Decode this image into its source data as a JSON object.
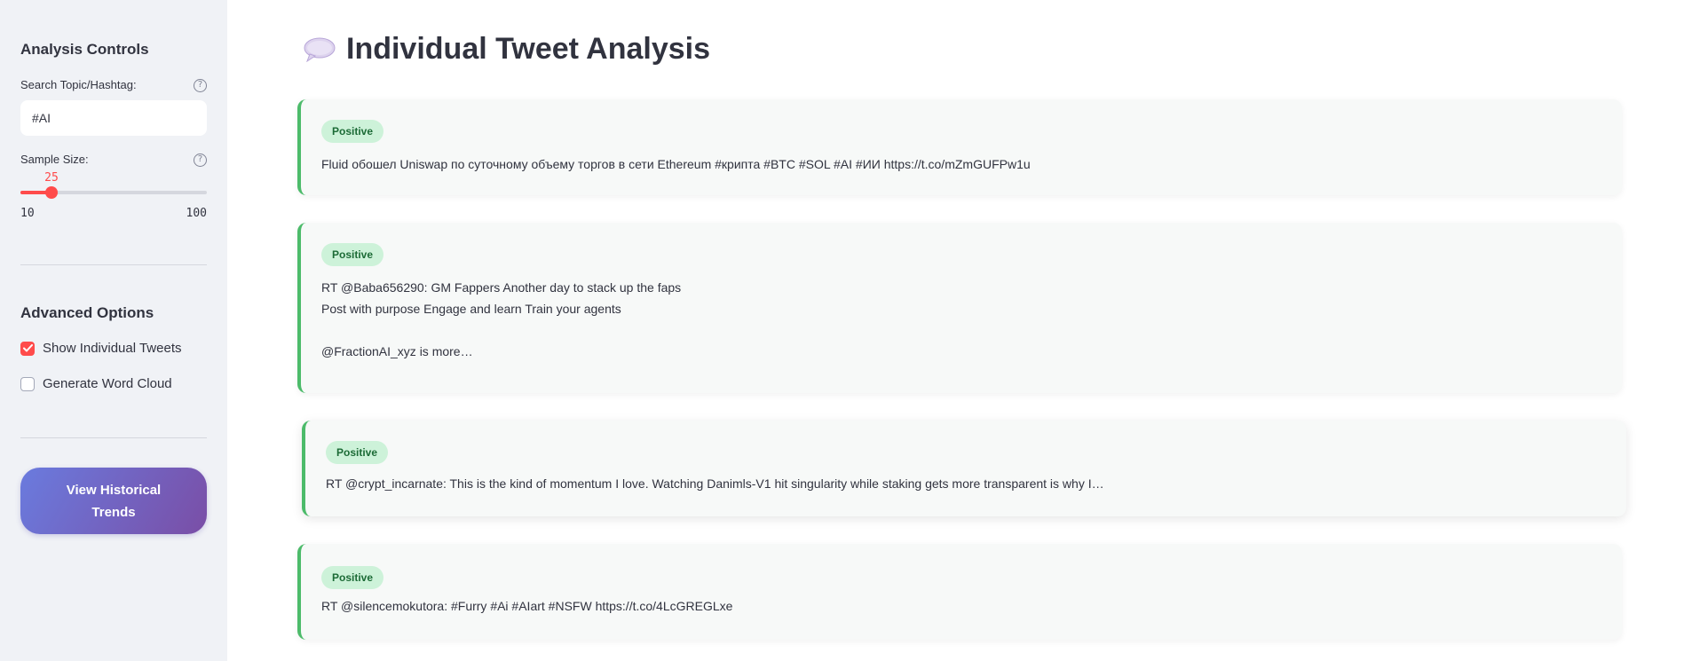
{
  "sidebar": {
    "analysis_heading": "Analysis Controls",
    "search_label": "Search Topic/Hashtag:",
    "search_value": "#AI",
    "sample_label": "Sample Size:",
    "slider": {
      "value": "25",
      "min": "10",
      "max": "100",
      "value_fraction": 0.1667
    },
    "advanced_heading": "Advanced Options",
    "show_tweets_label": "Show Individual Tweets",
    "show_tweets_checked": true,
    "word_cloud_label": "Generate Word Cloud",
    "word_cloud_checked": false,
    "historical_button": "View Historical Trends"
  },
  "main": {
    "title": "Individual Tweet Analysis",
    "title_icon": "speech-bubble-icon",
    "tweets": [
      {
        "sentiment": "Positive",
        "text": "Fluid обошел Uniswap по суточному объему торгов в сети Ethereum #крипта #BTC #SOL #AI #ИИ https://t.co/mZmGUFPw1u"
      },
      {
        "sentiment": "Positive",
        "text": "RT @Baba656290: GM Fappers Another day to stack up the faps\nPost with purpose Engage and learn Train your agents\n\n@FractionAI_xyz is more…"
      },
      {
        "sentiment": "Positive",
        "text": "RT @crypt_incarnate: This is the kind of momentum I love. Watching Danimls-V1 hit singularity while staking gets more transparent is why I…"
      },
      {
        "sentiment": "Positive",
        "text": "RT @silencemokutora: #Furry #Ai #AIart #NSFW https://t.co/4LcGREGLxe"
      }
    ]
  },
  "colors": {
    "accent": "#ff4b4b",
    "positive_border": "#4cbb6a",
    "positive_badge_bg": "#cdf2d9",
    "positive_badge_text": "#1c6b36",
    "button_gradient_start": "#6a7bde",
    "button_gradient_end": "#7a4ea6",
    "sidebar_bg": "#f0f2f6"
  }
}
